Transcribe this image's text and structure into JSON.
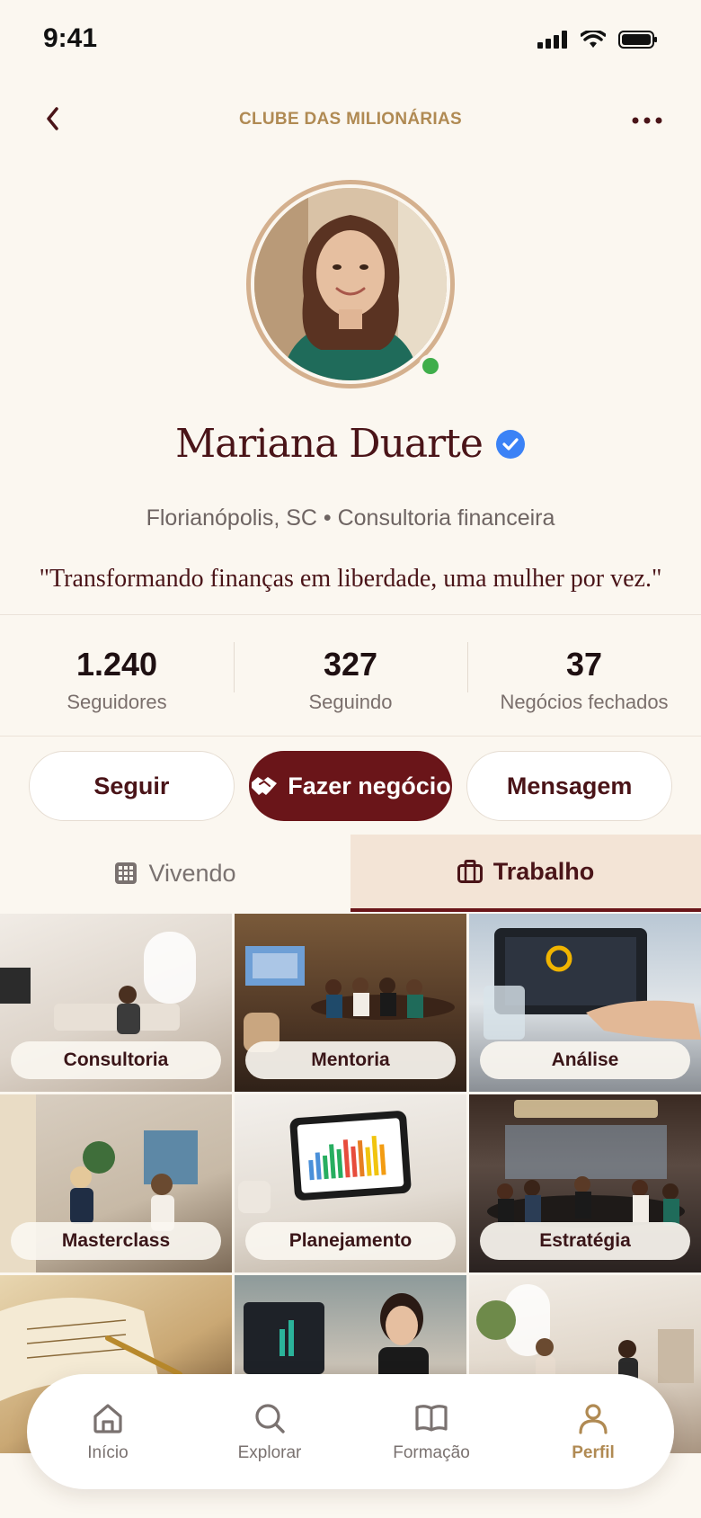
{
  "status": {
    "time": "9:41"
  },
  "header": {
    "title": "CLUBE DAS MILIONÁRIAS"
  },
  "profile": {
    "name": "Mariana Duarte",
    "meta": "Florianópolis, SC • Consultoria financeira",
    "quote": "\"Transformando finanças em liberdade, uma mulher por vez.\"",
    "online": true,
    "verified": true
  },
  "stats": [
    {
      "value": "1.240",
      "label": "Seguidores"
    },
    {
      "value": "327",
      "label": "Seguindo"
    },
    {
      "value": "37",
      "label": "Negócios fechados"
    }
  ],
  "actions": {
    "follow_label": "Seguir",
    "deal_label": "Fazer negócio",
    "message_label": "Mensagem"
  },
  "tabs": [
    {
      "label": "Vivendo",
      "icon": "grid-icon",
      "active": false
    },
    {
      "label": "Trabalho",
      "icon": "briefcase-icon",
      "active": true
    }
  ],
  "grid": [
    {
      "label": "Consultoria"
    },
    {
      "label": "Mentoria"
    },
    {
      "label": "Análise"
    },
    {
      "label": "Masterclass"
    },
    {
      "label": "Planejamento"
    },
    {
      "label": "Estratégia"
    },
    {
      "label": ""
    },
    {
      "label": ""
    },
    {
      "label": ""
    }
  ],
  "bottom_nav": [
    {
      "label": "Início",
      "icon": "home-icon",
      "active": false
    },
    {
      "label": "Explorar",
      "icon": "search-icon",
      "active": false
    },
    {
      "label": "Formação",
      "icon": "book-icon",
      "active": false
    },
    {
      "label": "Perfil",
      "icon": "user-icon",
      "active": true
    }
  ],
  "colors": {
    "brand_gold": "#b08a53",
    "primary_burgundy": "#6a1519",
    "background": "#fbf7f0",
    "online_green": "#3fae4b",
    "verified_blue": "#3b82f6"
  }
}
